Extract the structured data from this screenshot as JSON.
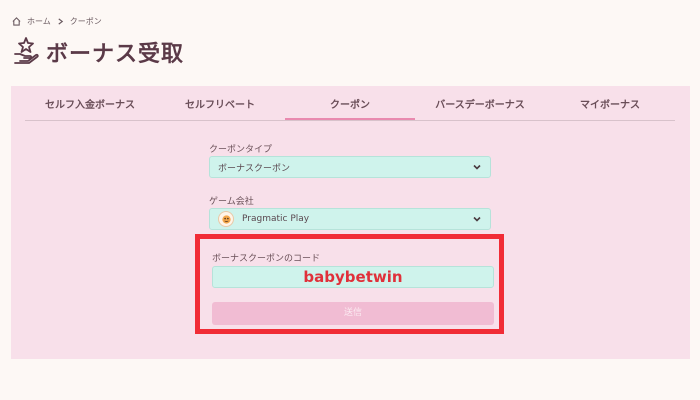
{
  "breadcrumb": {
    "home": "ホーム",
    "current": "クーポン"
  },
  "page": {
    "title": "ボーナス受取"
  },
  "tabs": [
    {
      "label": "セルフ入金ボーナス"
    },
    {
      "label": "セルフリベート"
    },
    {
      "label": "クーポン",
      "active": true
    },
    {
      "label": "バースデーボーナス"
    },
    {
      "label": "マイボーナス"
    }
  ],
  "form": {
    "coupon_type_label": "クーポンタイプ",
    "coupon_type_value": "ボーナスクーポン",
    "game_provider_label": "ゲーム会社",
    "game_provider_value": "Pragmatic Play",
    "code_label": "ボーナスクーポンのコード",
    "code_value": "babybetwin",
    "submit_label": "送信"
  },
  "colors": {
    "panel_bg": "#f8e0ea",
    "input_bg": "#cff3ec",
    "active_tab_underline": "#e98aaf",
    "highlight_border": "#f12c36",
    "submit_bg": "#f1bcd3"
  }
}
